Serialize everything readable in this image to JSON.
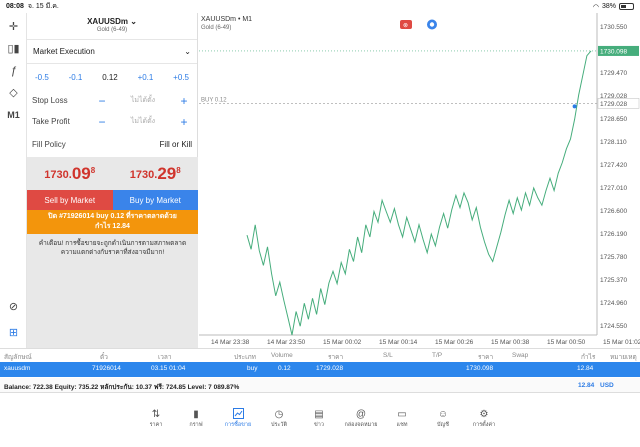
{
  "status": {
    "time": "08:08",
    "date": "จ. 15 มี.ค.",
    "battery": "38%",
    "battery_level": 0.38
  },
  "toolbar": {
    "m1_label": "M1"
  },
  "order_panel": {
    "symbol": "XAUUSDm",
    "description": "Gold (6-49)",
    "execution": "Market Execution",
    "volume": {
      "minus_big": "-0.5",
      "minus_small": "-0.1",
      "value": "0.12",
      "plus_small": "+0.1",
      "plus_big": "+0.5"
    },
    "stop_loss": {
      "label": "Stop Loss",
      "minus": "−",
      "value": "ไม่ได้ตั้ง",
      "plus": "+"
    },
    "take_profit": {
      "label": "Take Profit",
      "minus": "−",
      "value": "ไม่ได้ตั้ง",
      "plus": "+"
    },
    "fill_policy": {
      "label": "Fill Policy",
      "value": "Fill or Kill"
    },
    "bid": {
      "a": "1730.",
      "b": "09",
      "c": "8"
    },
    "ask": {
      "a": "1730.",
      "b": "29",
      "c": "8"
    },
    "sell_label": "Sell by Market",
    "buy_label": "Buy by Market",
    "close_line1": "ปิด #71926014 buy 0.12 ที่ราคาตลาดด้วย",
    "close_line2": "กำไร 12.84",
    "warning": "คำเตือน! การซื้อขายจะถูกดำเนินการตามสภาพตลาด ความแตกต่างกับราคาที่ส่งอาจมีมาก!"
  },
  "chart": {
    "symbol_label": "XAUUSDm • M1",
    "desc_label": "Gold (6-49)",
    "buy_line_label": "BUY 0.12",
    "current_price_label": "1730.098",
    "colors": {
      "line": "#46ad7c",
      "price_tag": "#46ad7c",
      "accent": "#2c7be5"
    }
  },
  "chart_data": {
    "type": "line",
    "series": [
      {
        "values": [
          1726.34,
          1726.05,
          1726.55,
          1726.02,
          1725.72,
          1726.1,
          1725.55,
          1725.1,
          1725.38,
          1725.0,
          1724.65,
          1724.3,
          1724.78,
          1724.48,
          1724.95,
          1724.62,
          1725.05,
          1724.72,
          1725.25,
          1724.92,
          1725.36,
          1725.6,
          1725.35,
          1725.78,
          1725.55,
          1726.05,
          1725.8,
          1726.3,
          1725.98,
          1726.55,
          1726.3,
          1726.82,
          1726.6,
          1727.05,
          1726.82,
          1726.6,
          1726.88,
          1726.55,
          1726.3,
          1726.7,
          1726.45,
          1726.2,
          1726.55,
          1726.25,
          1725.98,
          1726.36,
          1726.12,
          1726.5,
          1726.78,
          1726.48,
          1726.86,
          1727.15,
          1726.9,
          1727.2,
          1727.0,
          1726.65,
          1726.9,
          1726.5,
          1726.2,
          1725.95,
          1725.8,
          1726.1,
          1726.4,
          1726.75,
          1727.05,
          1726.78,
          1727.1,
          1726.85,
          1727.2,
          1726.95,
          1727.3,
          1727.1,
          1726.95,
          1727.25,
          1727.5,
          1727.25,
          1727.6,
          1727.82,
          1728.1,
          1728.3,
          1728.7,
          1729.2,
          1729.6,
          1730.0,
          1730.098
        ]
      }
    ],
    "x_ticks": [
      "14 Mar 23:38",
      "14 Mar 23:50",
      "15 Mar 00:02",
      "15 Mar 00:14",
      "15 Mar 00:26",
      "15 Mar 00:38",
      "15 Mar 00:50",
      "15 Mar 01:02"
    ],
    "y_ticks": [
      "1730.550",
      "1729.935",
      "1729.470",
      "1729.028",
      "1728.650",
      "1728.110",
      "1727.420",
      "1727.010",
      "1726.600",
      "1726.190",
      "1725.780",
      "1725.370",
      "1724.960",
      "1724.550"
    ],
    "ylim": [
      1724.3,
      1730.75
    ],
    "buy_level": 1729.028,
    "current": 1730.098,
    "grid": false
  },
  "positions": {
    "headers": {
      "symbol": "สัญลักษณ์",
      "ticket": "ตั๋ว",
      "time": "เวลา",
      "type": "ประเภท",
      "volume": "Volume",
      "price": "ราคา",
      "sl": "S/L",
      "tp": "T/P",
      "price2": "ราคา",
      "swap": "Swap",
      "profit": "กำไร",
      "comment": "หมายเหตุ"
    },
    "row": {
      "symbol": "xauusdm",
      "ticket": "71926014",
      "time": "03.15 01:04",
      "type": "buy",
      "volume": "0.12",
      "price": "1729.028",
      "price2": "1730.098",
      "profit": "12.84"
    },
    "balance_text": "Balance: 722.38 Equity: 735.22 หลักประกัน: 10.37 ฟรี: 724.85 Level: 7 089.87%",
    "balance_amount": "12.84",
    "currency": "USD"
  },
  "tabs": [
    {
      "label": "ราคา",
      "icon": "updown-arrows-icon",
      "glyph": "⇅"
    },
    {
      "label": "กราฟ",
      "icon": "candlestick-icon",
      "glyph": "▮"
    },
    {
      "label": "การซื้อขาย",
      "icon": "trade-icon",
      "glyph": "📈"
    },
    {
      "label": "ประวัติ",
      "icon": "history-icon",
      "glyph": "◷"
    },
    {
      "label": "ข่าว",
      "icon": "news-icon",
      "glyph": "▤"
    },
    {
      "label": "กล่องจดหมาย",
      "icon": "mailbox-icon",
      "glyph": "@"
    },
    {
      "label": "แชท",
      "icon": "chat-icon",
      "glyph": "▭"
    },
    {
      "label": "บัญชี",
      "icon": "account-icon",
      "glyph": "☺"
    },
    {
      "label": "การตั้งค่า",
      "icon": "settings-icon",
      "glyph": "⚙"
    }
  ]
}
